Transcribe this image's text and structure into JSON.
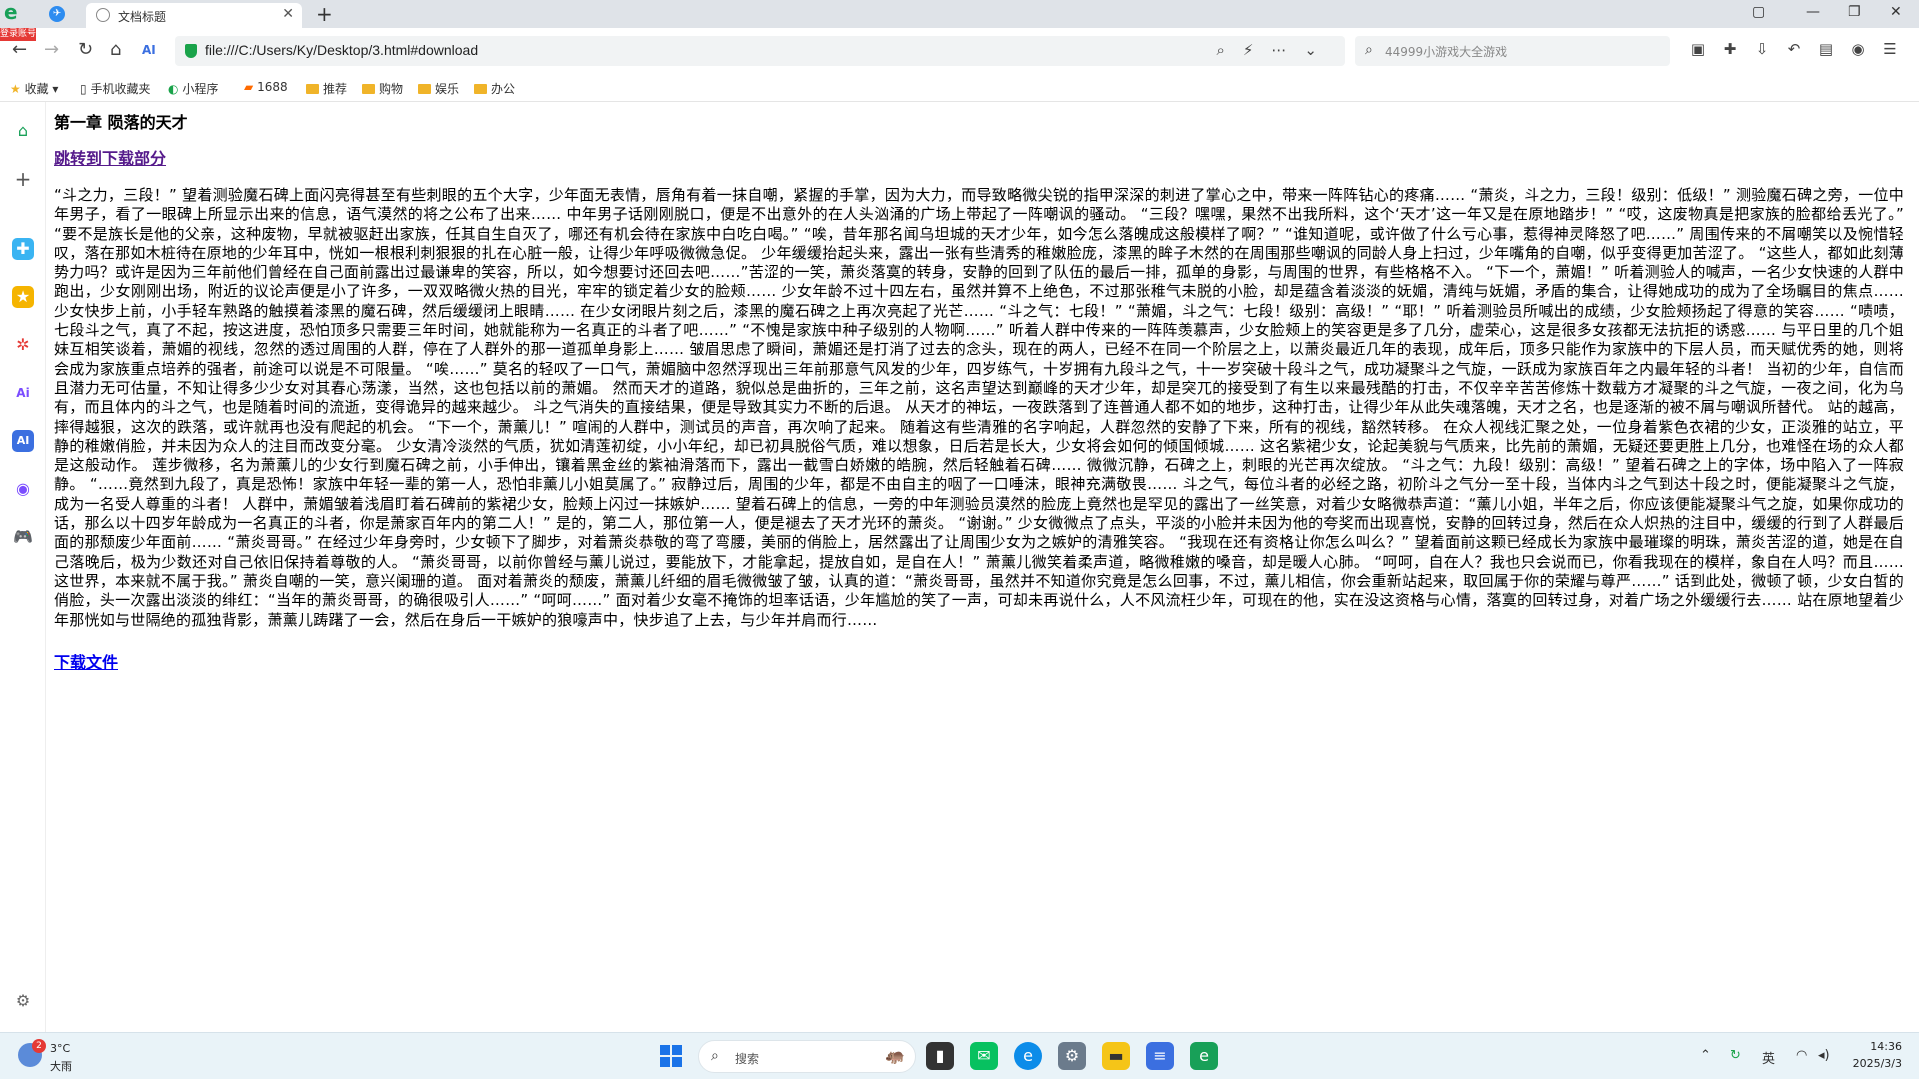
{
  "browser": {
    "login_badge": "登录账号",
    "tab_title": "文档标题",
    "url": "file:///C:/Users/Ky/Desktop/3.html#download",
    "search_placeholder": "44999小游戏大全游戏"
  },
  "bookmarks": [
    {
      "label": "收藏",
      "icon": "star-icon"
    },
    {
      "label": "手机收藏夹",
      "icon": "phone-icon"
    },
    {
      "label": "小程序",
      "icon": "miniprogram-icon"
    },
    {
      "label": "1688",
      "icon": "1688-icon"
    },
    {
      "label": "推荐",
      "icon": "folder-icon"
    },
    {
      "label": "购物",
      "icon": "folder-icon"
    },
    {
      "label": "娱乐",
      "icon": "folder-icon"
    },
    {
      "label": "办公",
      "icon": "folder-icon"
    }
  ],
  "page": {
    "chapter_title": "第一章 陨落的天才",
    "jump_link": "跳转到下载部分",
    "story": "“斗之力，三段！” 望着测验魔石碑上面闪亮得甚至有些刺眼的五个大字，少年面无表情，唇角有着一抹自嘲，紧握的手掌，因为大力，而导致略微尖锐的指甲深深的刺进了掌心之中，带来一阵阵钻心的疼痛…… “萧炎，斗之力，三段！级别：低级！” 测验魔石碑之旁，一位中年男子，看了一眼碑上所显示出来的信息，语气漠然的将之公布了出来…… 中年男子话刚刚脱口，便是不出意外的在人头汹涌的广场上带起了一阵嘲讽的骚动。 “三段？嘿嘿，果然不出我所料，这个‘天才’这一年又是在原地踏步！” “哎，这废物真是把家族的脸都给丢光了。” “要不是族长是他的父亲，这种废物，早就被驱赶出家族，任其自生自灭了，哪还有机会待在家族中白吃白喝。” “唉，昔年那名闻乌坦城的天才少年，如今怎么落魄成这般模样了啊？” “谁知道呢，或许做了什么亏心事，惹得神灵降怒了吧……” 周围传来的不屑嘲笑以及惋惜轻叹，落在那如木桩待在原地的少年耳中，恍如一根根利刺狠狠的扎在心脏一般，让得少年呼吸微微急促。 少年缓缓抬起头来，露出一张有些清秀的稚嫩脸庞，漆黑的眸子木然的在周围那些嘲讽的同龄人身上扫过，少年嘴角的自嘲，似乎变得更加苦涩了。 “这些人，都如此刻薄势力吗？或许是因为三年前他们曾经在自己面前露出过最谦卑的笑容，所以，如今想要讨还回去吧……”苦涩的一笑，萧炎落寞的转身，安静的回到了队伍的最后一排，孤单的身影，与周围的世界，有些格格不入。 “下一个，萧媚！” 听着测验人的喊声，一名少女快速的人群中跑出，少女刚刚出场，附近的议论声便是小了许多，一双双略微火热的目光，牢牢的锁定着少女的脸颊…… 少女年龄不过十四左右，虽然并算不上绝色，不过那张稚气未脱的小脸，却是蕴含着淡淡的妩媚，清纯与妩媚，矛盾的集合，让得她成功的成为了全场瞩目的焦点…… 少女快步上前，小手轻车熟路的触摸着漆黑的魔石碑，然后缓缓闭上眼睛…… 在少女闭眼片刻之后，漆黑的魔石碑之上再次亮起了光芒…… “斗之气：七段！” “萧媚，斗之气：七段！级别：高级！” “耶！” 听着测验员所喊出的成绩，少女脸颊扬起了得意的笑容…… “啧啧，七段斗之气，真了不起，按这进度，恐怕顶多只需要三年时间，她就能称为一名真正的斗者了吧……” “不愧是家族中种子级别的人物啊……” 听着人群中传来的一阵阵羡慕声，少女脸颊上的笑容更是多了几分，虚荣心，这是很多女孩都无法抗拒的诱惑…… 与平日里的几个姐妹互相笑谈着，萧媚的视线，忽然的透过周围的人群，停在了人群外的那一道孤单身影上…… 皱眉思虑了瞬间，萧媚还是打消了过去的念头，现在的两人，已经不在同一个阶层之上，以萧炎最近几年的表现，成年后，顶多只能作为家族中的下层人员，而天赋优秀的她，则将会成为家族重点培养的强者，前途可以说是不可限量。 “唉……” 莫名的轻叹了一口气，萧媚脑中忽然浮现出三年前那意气风发的少年，四岁练气，十岁拥有九段斗之气，十一岁突破十段斗之气，成功凝聚斗之气旋，一跃成为家族百年之内最年轻的斗者！ 当初的少年，自信而且潜力无可估量，不知让得多少少女对其春心荡漾，当然，这也包括以前的萧媚。 然而天才的道路，貌似总是曲折的，三年之前，这名声望达到巅峰的天才少年，却是突兀的接受到了有生以来最残酷的打击，不仅辛辛苦苦修炼十数载方才凝聚的斗之气旋，一夜之间，化为乌有，而且体内的斗之气，也是随着时间的流逝，变得诡异的越来越少。 斗之气消失的直接结果，便是导致其实力不断的后退。 从天才的神坛，一夜跌落到了连普通人都不如的地步，这种打击，让得少年从此失魂落魄，天才之名，也是逐渐的被不屑与嘲讽所替代。 站的越高，摔得越狠，这次的跌落，或许就再也没有爬起的机会。 “下一个，萧薰儿！” 喧闹的人群中，测试员的声音，再次响了起来。 随着这有些清雅的名字响起，人群忽然的安静了下来，所有的视线，豁然转移。 在众人视线汇聚之处，一位身着紫色衣裙的少女，正淡雅的站立，平静的稚嫩俏脸，并未因为众人的注目而改变分毫。 少女清冷淡然的气质，犹如清莲初绽，小小年纪，却已初具脱俗气质，难以想象，日后若是长大，少女将会如何的倾国倾城…… 这名紫裙少女，论起美貌与气质来，比先前的萧媚，无疑还要更胜上几分，也难怪在场的众人都是这般动作。 莲步微移，名为萧薰儿的少女行到魔石碑之前，小手伸出，镶着黑金丝的紫袖滑落而下，露出一截雪白娇嫩的皓腕，然后轻触着石碑…… 微微沉静，石碑之上，刺眼的光芒再次绽放。 “斗之气：九段！级别：高级！” 望着石碑之上的字体，场中陷入了一阵寂静。 “……竟然到九段了，真是恐怖！家族中年轻一辈的第一人，恐怕非薰儿小姐莫属了。” 寂静过后，周围的少年，都是不由自主的咽了一口唾沫，眼神充满敬畏…… 斗之气，每位斗者的必经之路，初阶斗之气分一至十段，当体内斗之气到达十段之时，便能凝聚斗之气旋，成为一名受人尊重的斗者！ 人群中，萧媚皱着浅眉盯着石碑前的紫裙少女，脸颊上闪过一抹嫉妒…… 望着石碑上的信息，一旁的中年测验员漠然的脸庞上竟然也是罕见的露出了一丝笑意，对着少女略微恭声道：“薰儿小姐，半年之后，你应该便能凝聚斗气之旋，如果你成功的话，那么以十四岁年龄成为一名真正的斗者，你是萧家百年内的第二人！” 是的，第二人，那位第一人，便是褪去了天才光环的萧炎。 “谢谢。” 少女微微点了点头，平淡的小脸并未因为他的夸奖而出现喜悦，安静的回转过身，然后在众人炽热的注目中，缓缓的行到了人群最后面的那颓废少年面前…… “萧炎哥哥。” 在经过少年身旁时，少女顿下了脚步，对着萧炎恭敬的弯了弯腰，美丽的俏脸上，居然露出了让周围少女为之嫉妒的清雅笑容。 “我现在还有资格让你怎么叫么？” 望着面前这颗已经成长为家族中最璀璨的明珠，萧炎苦涩的道，她是在自己落晚后，极为少数还对自己依旧保持着尊敬的人。 “萧炎哥哥，以前你曾经与薰儿说过，要能放下，才能拿起，提放自如，是自在人！” 萧薰儿微笑着柔声道，略微稚嫩的嗓音，却是暖人心肺。 “呵呵，自在人？我也只会说而已，你看我现在的模样，象自在人吗？而且……这世界，本来就不属于我。” 萧炎自嘲的一笑，意兴阑珊的道。 面对着萧炎的颓废，萧薰儿纤细的眉毛微微皱了皱，认真的道：“萧炎哥哥，虽然并不知道你究竟是怎么回事，不过，薰儿相信，你会重新站起来，取回属于你的荣耀与尊严……” 话到此处，微顿了顿，少女白皙的俏脸，头一次露出淡淡的绯红：“当年的萧炎哥哥，的确很吸引人……” “呵呵……” 面对着少女毫不掩饰的坦率话语，少年尴尬的笑了一声，可却未再说什么，人不风流枉少年，可现在的他，实在没这资格与心情，落寞的回转过身，对着广场之外缓缓行去…… 站在原地望着少年那恍如与世隔绝的孤独背影，萧薰儿踌躇了一会，然后在身后一干嫉妒的狼嚎声中，快步追了上去，与少年并肩而行……",
    "download_link": "下载文件"
  },
  "taskbar": {
    "weather_badge": "2",
    "weather_temp": "3°C",
    "weather_desc": "大雨",
    "search_label": "搜索",
    "ime": "英",
    "time": "14:36",
    "date": "2025/3/3"
  },
  "colors": {
    "visited_link": "#551a8b",
    "link": "#0000ee",
    "tabbar_bg": "#dfe3e8",
    "taskbar_bg": "#e9f3f8",
    "accent_green": "#18a058"
  }
}
